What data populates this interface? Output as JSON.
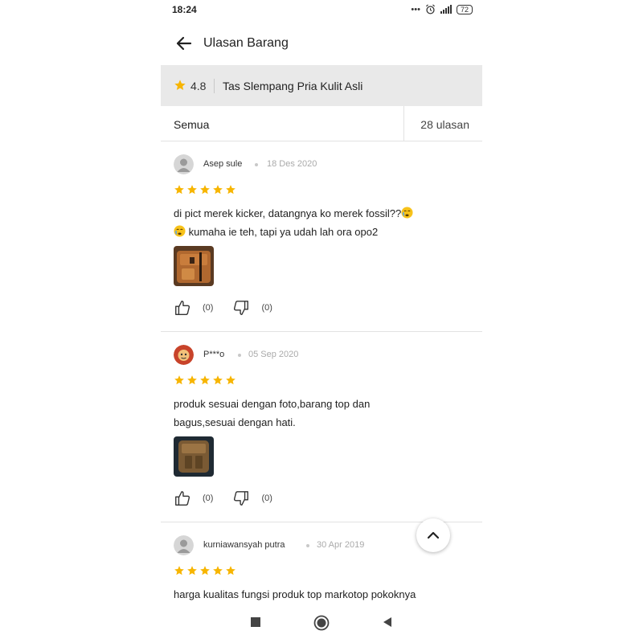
{
  "status_bar": {
    "time": "18:24",
    "dots": "•••",
    "battery": "72"
  },
  "header": {
    "title": "Ulasan Barang"
  },
  "product": {
    "rating": "4.8",
    "name": "Tas Slempang Pria Kulit Asli"
  },
  "filter": {
    "all_label": "Semua",
    "count_label": "28 ulasan"
  },
  "reviews": [
    {
      "name": "Asep sule",
      "date": "18 Des 2020",
      "stars": 5,
      "text_line1": "di pict merek kicker, datangnya ko merek fossil??",
      "text_line2": " kumaha ie teh, tapi ya udah lah ora opo2",
      "likes": "(0)",
      "dislikes": "(0)"
    },
    {
      "name": "P***o",
      "date": "05 Sep 2020",
      "stars": 5,
      "text_line1": "produk sesuai dengan foto,barang top dan",
      "text_line2": "bagus,sesuai dengan hati.",
      "likes": "(0)",
      "dislikes": "(0)"
    },
    {
      "name": "kurniawansyah putra",
      "date": "30 Apr 2019",
      "stars": 5,
      "text_line1": "harga kualitas fungsi produk  top markotop pokoknya"
    }
  ],
  "colors": {
    "star": "#f7b500",
    "product_bar": "#e9e9e9",
    "divider": "#e2e2e2"
  },
  "icons": [
    "back-arrow-icon",
    "star-icon",
    "thumbs-up-icon",
    "thumbs-down-icon",
    "chevron-up-icon",
    "home-square-icon",
    "home-circle-icon",
    "back-triangle-icon"
  ]
}
